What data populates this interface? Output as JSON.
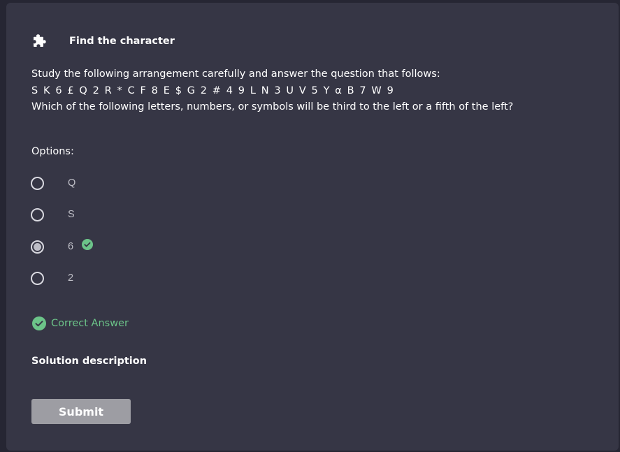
{
  "header": {
    "title": "Find the character",
    "icon": "puzzle-piece-icon"
  },
  "question": {
    "instruction": "Study the following arrangement carefully and answer the question that follows:",
    "sequence": "S K 6 £ Q 2 R * C F 8 E $ G 2 # 4 9 L N 3 U V 5 Y α B 7 W 9",
    "prompt": "Which of the following letters, numbers, or symbols will be third to the left or a fifth of the left?"
  },
  "options_label": "Options:",
  "options": [
    {
      "label": "Q",
      "selected": false,
      "correct": false
    },
    {
      "label": "S",
      "selected": false,
      "correct": false
    },
    {
      "label": "6",
      "selected": true,
      "correct": true
    },
    {
      "label": "2",
      "selected": false,
      "correct": false
    }
  ],
  "result": {
    "text": "Correct Answer",
    "icon": "check-circle-icon"
  },
  "solution_title": "Solution description",
  "submit_label": "Submit",
  "colors": {
    "background": "#262633",
    "card": "#363645",
    "correct": "#6cc489",
    "button": "#9d9da3"
  }
}
